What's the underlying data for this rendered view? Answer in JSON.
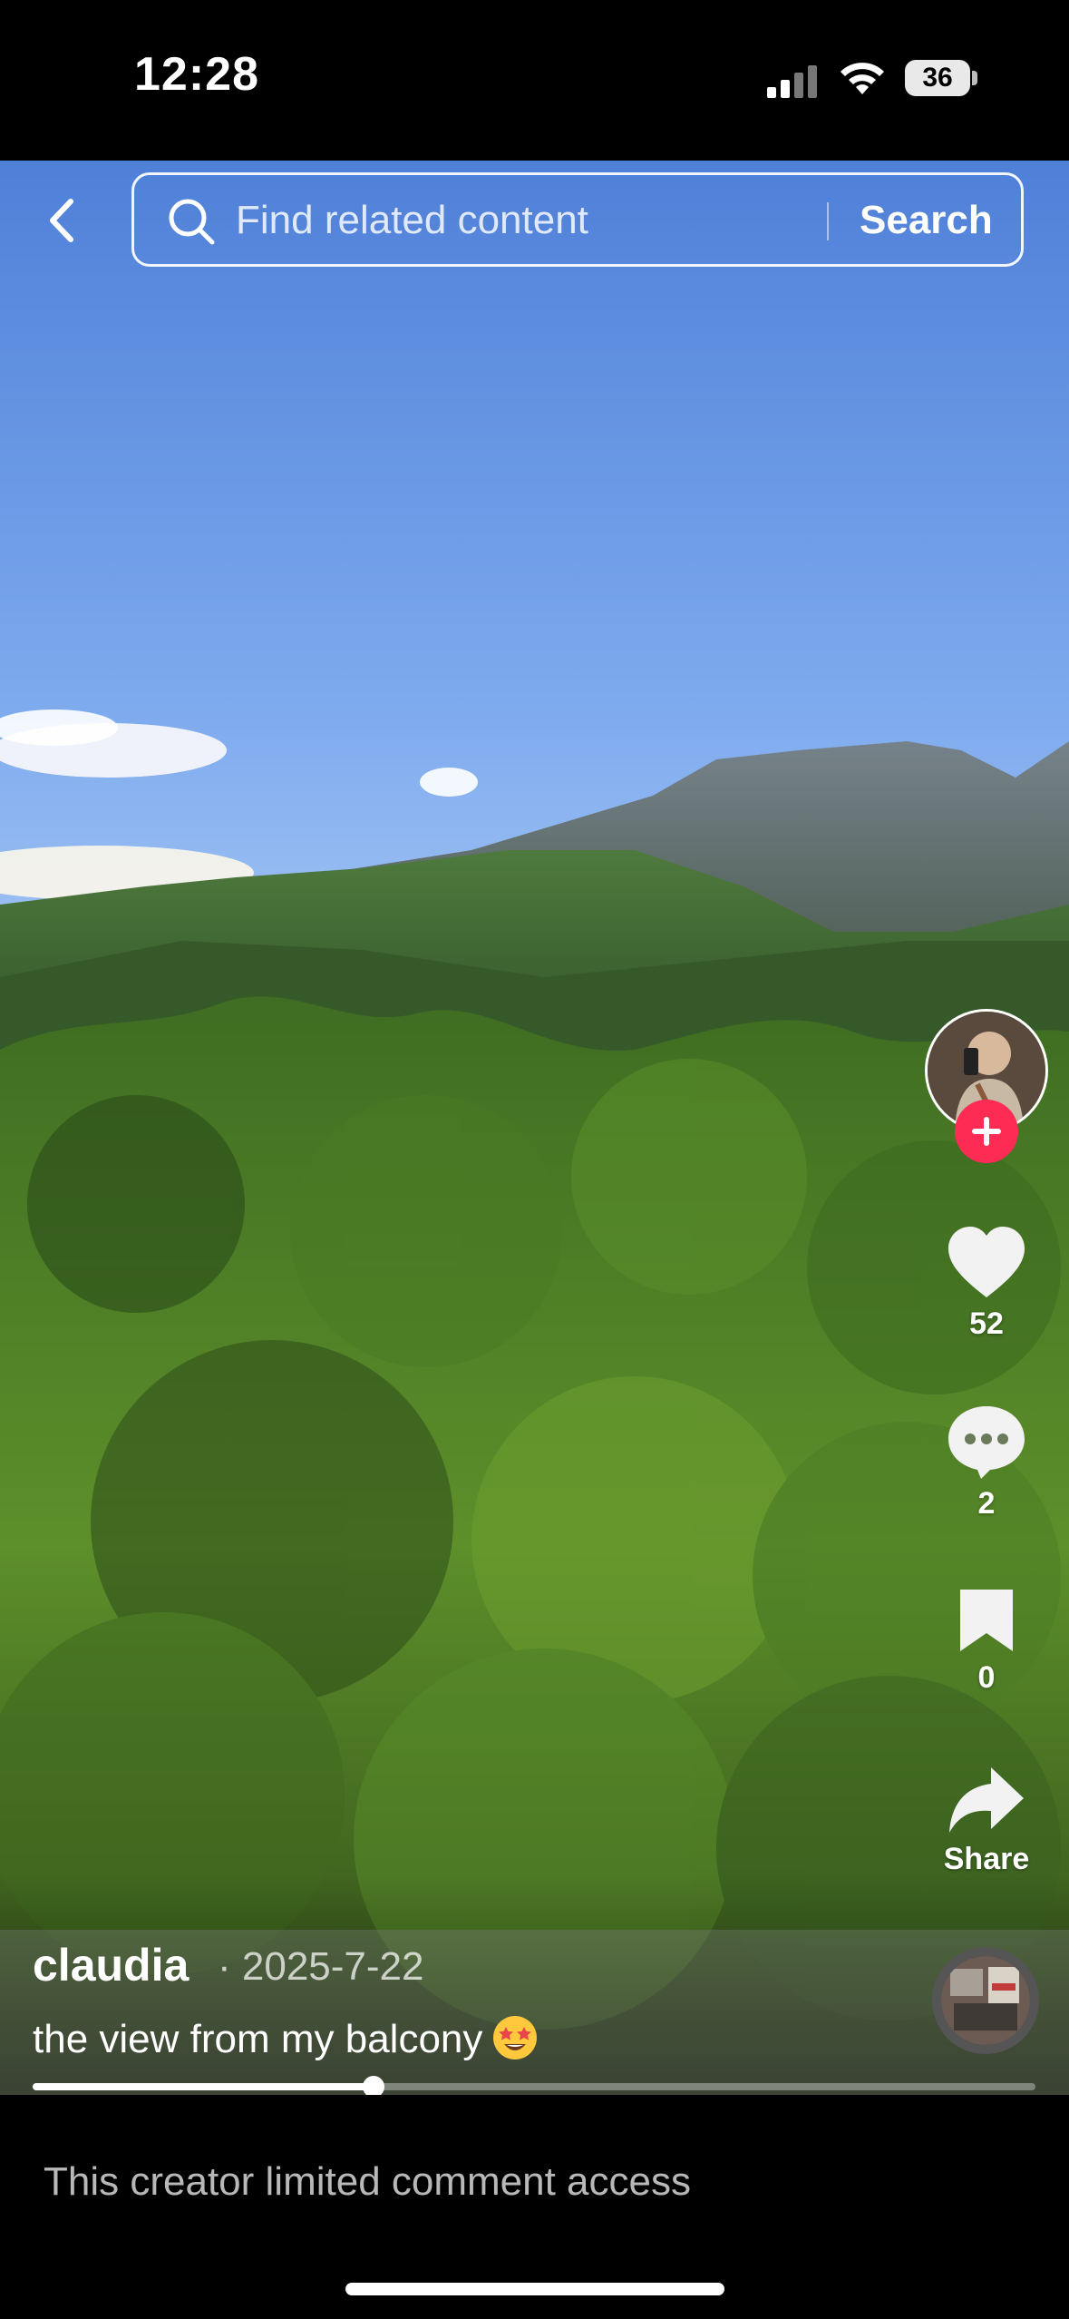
{
  "status_bar": {
    "time": "12:28",
    "battery": "36",
    "icons": [
      "signal-icon",
      "wifi-icon",
      "battery-icon"
    ]
  },
  "search": {
    "placeholder": "Find related content",
    "button_label": "Search",
    "icons": [
      "back-icon",
      "search-icon"
    ]
  },
  "actions": {
    "likes": "52",
    "comments": "2",
    "saves": "0",
    "share_label": "Share",
    "icons": [
      "heart-icon",
      "comment-icon",
      "bookmark-icon",
      "share-icon",
      "plus-icon"
    ]
  },
  "post": {
    "username": "claudia",
    "date": "· 2025-7-22",
    "caption": "the view from my balcony",
    "caption_emoji": "star-struck-emoji",
    "progress": 0.34
  },
  "comments": {
    "notice": "This creator limited comment access"
  },
  "colors": {
    "follow_red": "#fe2c55",
    "sky_top": "#5f8fe0",
    "sky_bottom": "#9fc7f5"
  }
}
